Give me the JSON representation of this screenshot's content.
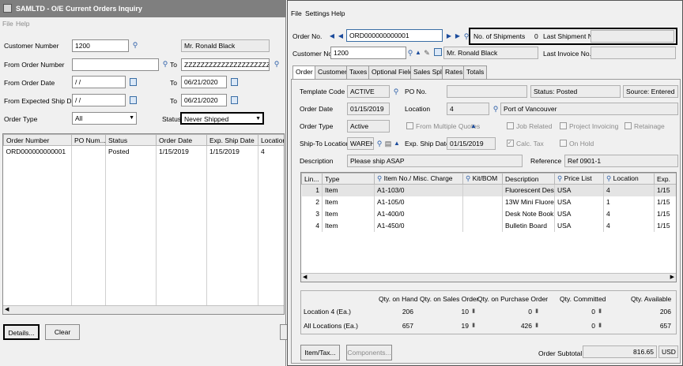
{
  "left": {
    "title": "SAMLTD - O/E Current Orders Inquiry",
    "menu": [
      "File",
      "Help"
    ],
    "customer_number_label": "Customer Number",
    "customer_number": "1200",
    "customer_name": "Mr. Ronald Black",
    "from_order_number_label": "From Order Number",
    "from_order_number": "",
    "to_label": "To",
    "to_order_number": "ZZZZZZZZZZZZZZZZZZZZZZ",
    "from_order_date_label": "From Order Date",
    "from_order_date": "/ /",
    "to_order_date": "06/21/2020",
    "from_exp_ship_label": "From Expected Ship Date",
    "from_exp_ship": "/ /",
    "to_exp_ship": "06/21/2020",
    "order_type_label": "Order Type",
    "order_type": "All",
    "status_label": "Status",
    "status": "Never Shipped",
    "columns": [
      "Order Number",
      "PO Num...",
      "Status",
      "Order Date",
      "Exp. Ship Date",
      "Location"
    ],
    "rows": [
      [
        "ORD000000000001",
        "",
        "Posted",
        "1/15/2019",
        "1/15/2019",
        "4"
      ]
    ],
    "details_button": "Details...",
    "clear_button": "Clear"
  },
  "right": {
    "menu": [
      "File",
      "Settings",
      "Help"
    ],
    "order_no_label": "Order No.",
    "order_no": "ORD000000000001",
    "shipments_label": "No. of Shipments",
    "shipments": "0",
    "last_shipment_label": "Last Shipment No.",
    "last_shipment": "",
    "customer_no_label": "Customer No.",
    "customer_no": "1200",
    "customer_name": "Mr. Ronald Black",
    "last_invoice_label": "Last Invoice No.",
    "last_invoice": "",
    "tabs": [
      "Order",
      "Customer",
      "Taxes",
      "Optional Fields",
      "Sales Split",
      "Rates",
      "Totals"
    ],
    "template_code_label": "Template Code",
    "template_code": "ACTIVE",
    "po_no_label": "PO No.",
    "po_no": "",
    "status_text": "Status: Posted",
    "source_text": "Source: Entered",
    "order_date_label": "Order Date",
    "order_date": "01/15/2019",
    "location_label": "Location",
    "location": "4",
    "location_name": "Port of Vancouver",
    "order_type_label": "Order Type",
    "order_type": "Active",
    "multi_quotes_label": "From Multiple Quotes",
    "job_related_label": "Job Related",
    "project_invoicing_label": "Project Invoicing",
    "retainage_label": "Retainage",
    "ship_to_label": "Ship-To Location",
    "ship_to": "WAREHS",
    "exp_ship_label": "Exp. Ship Date",
    "exp_ship": "01/15/2019",
    "calc_tax_label": "Calc. Tax",
    "on_hold_label": "On Hold",
    "description_label": "Description",
    "description": "Please ship ASAP",
    "reference_label": "Reference",
    "reference": "Ref 0901-1",
    "columns": [
      "Lin...",
      "Type",
      "Item No./ Misc. Charge",
      "Kit/BOM",
      "Description",
      "Price List",
      "Location",
      "Exp."
    ],
    "lines": [
      [
        "1",
        "Item",
        "A1-103/0",
        "",
        "Fluorescent Des...",
        "USA",
        "4",
        "1/15"
      ],
      [
        "2",
        "Item",
        "A1-105/0",
        "",
        "13W Mini Fluore...",
        "USA",
        "1",
        "1/15"
      ],
      [
        "3",
        "Item",
        "A1-400/0",
        "",
        "Desk Note Book",
        "USA",
        "4",
        "1/15"
      ],
      [
        "4",
        "Item",
        "A1-450/0",
        "",
        "Bulletin Board",
        "USA",
        "4",
        "1/15"
      ]
    ],
    "qty_headers": [
      "Qty. on Hand",
      "Qty. on Sales Order",
      "Qty. on Purchase Order",
      "Qty. Committed",
      "Qty. Available"
    ],
    "qty_rows": [
      {
        "label": "Location  4 (Ea.)",
        "values": [
          "206",
          "10",
          "0",
          "0",
          "206"
        ]
      },
      {
        "label": "All Locations (Ea.)",
        "values": [
          "657",
          "19",
          "426",
          "0",
          "657"
        ]
      }
    ],
    "item_tax_button": "Item/Tax...",
    "components_button": "Components...",
    "order_subtotal_label": "Order Subtotal",
    "order_subtotal": "816.65",
    "currency": "USD"
  }
}
